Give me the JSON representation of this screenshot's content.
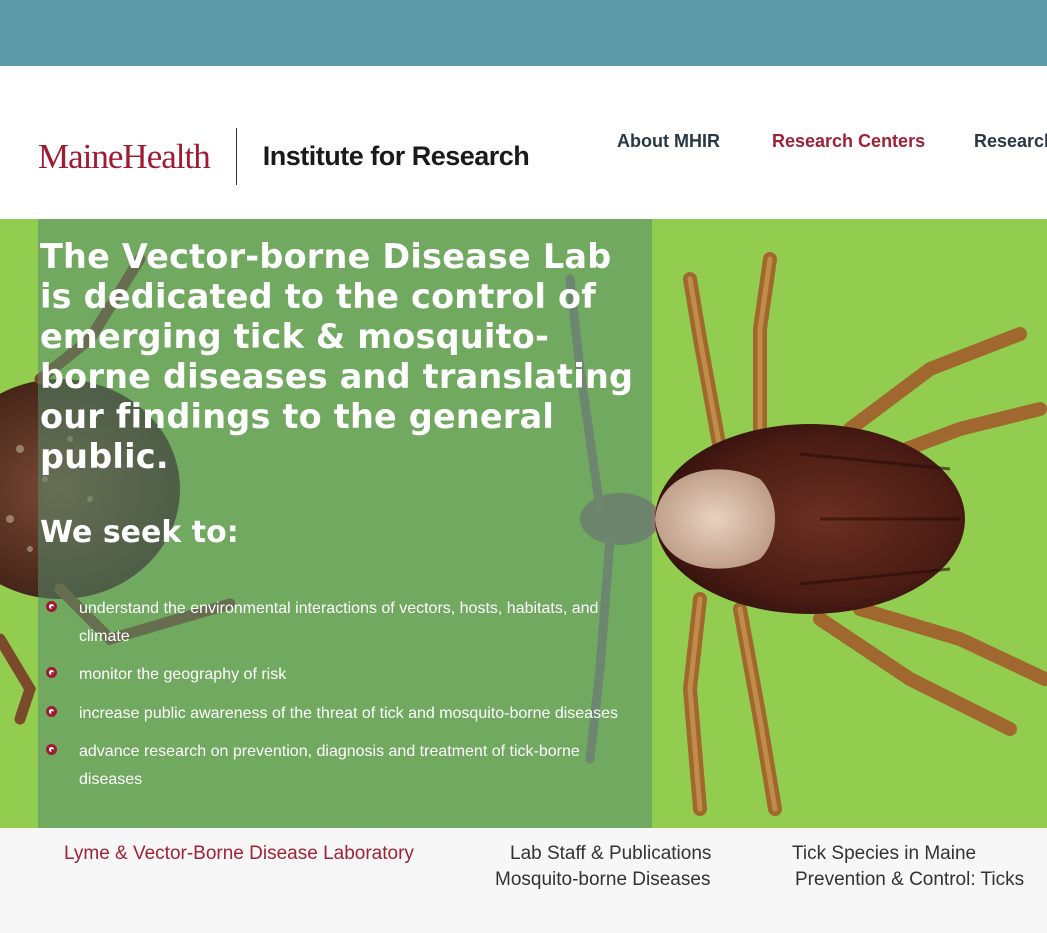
{
  "header": {
    "logo_brand": "MaineHealth",
    "logo_institute": "Institute for Research"
  },
  "nav": {
    "items": [
      {
        "label": "About MHIR"
      },
      {
        "label": "Research Centers"
      },
      {
        "label": "Research"
      }
    ]
  },
  "hero": {
    "title": "The Vector-borne Disease Lab is dedicated to the control of emerging tick & mosquito-borne diseases and translating our findings to the general public.",
    "subtitle": "We seek to:",
    "bullets": [
      "understand the environmental interactions of vectors, hosts, habitats, and climate",
      "monitor the geography of risk",
      "increase public awareness of the threat of tick and mosquito-borne diseases",
      "advance research on prevention, diagnosis and treatment of tick-borne diseases"
    ]
  },
  "subnav": {
    "links": [
      {
        "label": "Lyme & Vector-Borne Disease Laboratory"
      },
      {
        "label": "Lab Staff & Publications"
      },
      {
        "label": "Mosquito-borne Diseases"
      },
      {
        "label": "Tick Species in Maine"
      },
      {
        "label": "Prevention & Control: Ticks"
      }
    ]
  },
  "colors": {
    "topbar": "#5f9aab",
    "brand": "#9e1b32",
    "nav_text": "#2a3744",
    "overlay": "rgba(85,140,110,0.55)"
  }
}
